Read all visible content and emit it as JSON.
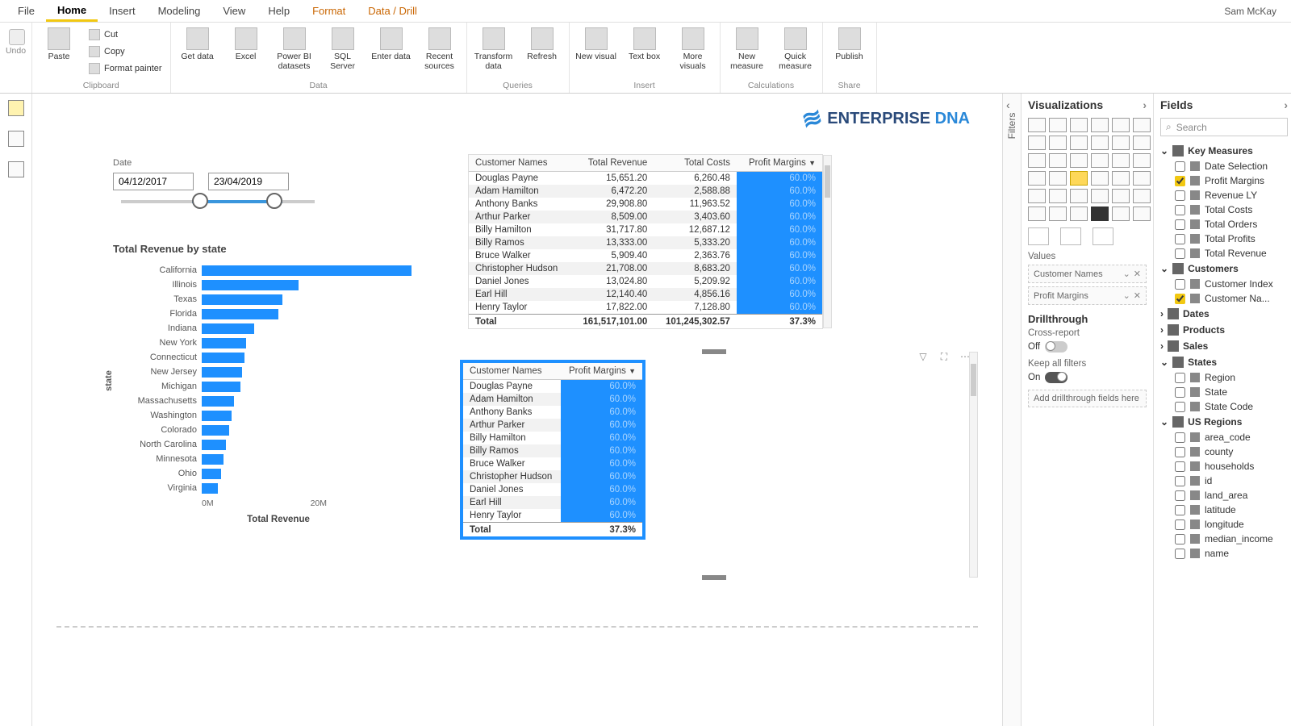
{
  "user": "Sam McKay",
  "menu": [
    "File",
    "Home",
    "Insert",
    "Modeling",
    "View",
    "Help",
    "Format",
    "Data / Drill"
  ],
  "menu_active": 1,
  "menu_orange": [
    6,
    7
  ],
  "ribbon": {
    "undo": "Undo",
    "clipboard": {
      "label": "Clipboard",
      "paste": "Paste",
      "cut": "Cut",
      "copy": "Copy",
      "format": "Format painter"
    },
    "data": {
      "label": "Data",
      "get": "Get data",
      "excel": "Excel",
      "pbi": "Power BI datasets",
      "sql": "SQL Server",
      "enter": "Enter data",
      "recent": "Recent sources"
    },
    "queries": {
      "label": "Queries",
      "transform": "Transform data",
      "refresh": "Refresh"
    },
    "insert": {
      "label": "Insert",
      "newv": "New visual",
      "text": "Text box",
      "more": "More visuals"
    },
    "calc": {
      "label": "Calculations",
      "newm": "New measure",
      "quick": "Quick measure"
    },
    "share": {
      "label": "Share",
      "publish": "Publish"
    }
  },
  "slicer": {
    "label": "Date",
    "from": "04/12/2017",
    "to": "23/04/2019"
  },
  "logo": {
    "a": "ENTERPRISE",
    "b": "DNA"
  },
  "chart_data": {
    "type": "bar",
    "title": "Total Revenue by state",
    "ylabel": "state",
    "xlabel": "Total Revenue",
    "xticks": [
      "0M",
      "20M"
    ],
    "categories": [
      "California",
      "Illinois",
      "Texas",
      "Florida",
      "Indiana",
      "New York",
      "Connecticut",
      "New Jersey",
      "Michigan",
      "Massachusetts",
      "Washington",
      "Colorado",
      "North Carolina",
      "Minnesota",
      "Ohio",
      "Virginia"
    ],
    "values": [
      26,
      12,
      10,
      9.5,
      6.5,
      5.5,
      5.3,
      5,
      4.8,
      4,
      3.7,
      3.4,
      3,
      2.7,
      2.4,
      2
    ]
  },
  "table1": {
    "cols": [
      "Customer Names",
      "Total Revenue",
      "Total Costs",
      "Profit Margins"
    ],
    "rows": [
      [
        "Douglas Payne",
        "15,651.20",
        "6,260.48",
        "60.0%"
      ],
      [
        "Adam Hamilton",
        "6,472.20",
        "2,588.88",
        "60.0%"
      ],
      [
        "Anthony Banks",
        "29,908.80",
        "11,963.52",
        "60.0%"
      ],
      [
        "Arthur Parker",
        "8,509.00",
        "3,403.60",
        "60.0%"
      ],
      [
        "Billy Hamilton",
        "31,717.80",
        "12,687.12",
        "60.0%"
      ],
      [
        "Billy Ramos",
        "13,333.00",
        "5,333.20",
        "60.0%"
      ],
      [
        "Bruce Walker",
        "5,909.40",
        "2,363.76",
        "60.0%"
      ],
      [
        "Christopher Hudson",
        "21,708.00",
        "8,683.20",
        "60.0%"
      ],
      [
        "Daniel Jones",
        "13,024.80",
        "5,209.92",
        "60.0%"
      ],
      [
        "Earl Hill",
        "12,140.40",
        "4,856.16",
        "60.0%"
      ],
      [
        "Henry Taylor",
        "17,822.00",
        "7,128.80",
        "60.0%"
      ]
    ],
    "total": [
      "Total",
      "161,517,101.00",
      "101,245,302.57",
      "37.3%"
    ]
  },
  "table2": {
    "cols": [
      "Customer Names",
      "Profit Margins"
    ],
    "rows": [
      [
        "Douglas Payne",
        "60.0%"
      ],
      [
        "Adam Hamilton",
        "60.0%"
      ],
      [
        "Anthony Banks",
        "60.0%"
      ],
      [
        "Arthur Parker",
        "60.0%"
      ],
      [
        "Billy Hamilton",
        "60.0%"
      ],
      [
        "Billy Ramos",
        "60.0%"
      ],
      [
        "Bruce Walker",
        "60.0%"
      ],
      [
        "Christopher Hudson",
        "60.0%"
      ],
      [
        "Daniel Jones",
        "60.0%"
      ],
      [
        "Earl Hill",
        "60.0%"
      ],
      [
        "Henry Taylor",
        "60.0%"
      ]
    ],
    "total": [
      "Total",
      "37.3%"
    ]
  },
  "viz": {
    "title": "Visualizations",
    "values": "Values",
    "well1": "Customer Names",
    "well2": "Profit Margins",
    "drill": "Drillthrough",
    "cross": "Cross-report",
    "off": "Off",
    "keep": "Keep all filters",
    "on": "On",
    "adddrill": "Add drillthrough fields here"
  },
  "filters_label": "Filters",
  "fields": {
    "title": "Fields",
    "search": "Search",
    "groups": [
      {
        "name": "Key Measures",
        "open": true,
        "items": [
          {
            "n": "Date Selection",
            "c": false
          },
          {
            "n": "Profit Margins",
            "c": true
          },
          {
            "n": "Revenue LY",
            "c": false
          },
          {
            "n": "Total Costs",
            "c": false
          },
          {
            "n": "Total Orders",
            "c": false
          },
          {
            "n": "Total Profits",
            "c": false
          },
          {
            "n": "Total Revenue",
            "c": false
          }
        ]
      },
      {
        "name": "Customers",
        "open": true,
        "items": [
          {
            "n": "Customer Index",
            "c": false
          },
          {
            "n": "Customer Na...",
            "c": true
          }
        ]
      },
      {
        "name": "Dates",
        "open": false
      },
      {
        "name": "Products",
        "open": false
      },
      {
        "name": "Sales",
        "open": false
      },
      {
        "name": "States",
        "open": true,
        "items": [
          {
            "n": "Region",
            "c": false
          },
          {
            "n": "State",
            "c": false
          },
          {
            "n": "State Code",
            "c": false
          }
        ]
      },
      {
        "name": "US Regions",
        "open": true,
        "items": [
          {
            "n": "area_code",
            "c": false
          },
          {
            "n": "county",
            "c": false
          },
          {
            "n": "households",
            "c": false
          },
          {
            "n": "id",
            "c": false
          },
          {
            "n": "land_area",
            "c": false
          },
          {
            "n": "latitude",
            "c": false
          },
          {
            "n": "longitude",
            "c": false
          },
          {
            "n": "median_income",
            "c": false
          },
          {
            "n": "name",
            "c": false
          }
        ]
      }
    ]
  }
}
